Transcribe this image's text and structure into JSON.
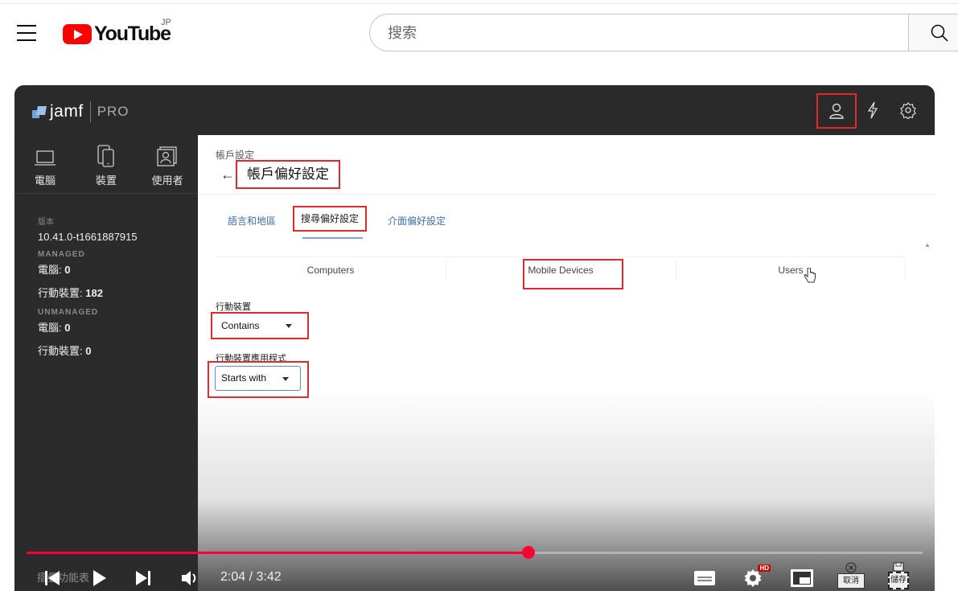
{
  "youtube": {
    "logo_text": "YouTube",
    "region": "JP",
    "search_placeholder": "搜索"
  },
  "jamf": {
    "brand": "jamf",
    "product": "PRO",
    "nav": [
      {
        "label": "電腦",
        "icon": "laptop-icon"
      },
      {
        "label": "裝置",
        "icon": "mobile-device-icon"
      },
      {
        "label": "使用者",
        "icon": "user-card-icon"
      }
    ],
    "info": {
      "version_label": "版本",
      "version": "10.41.0-t1661887915",
      "managed_label": "MANAGED",
      "managed_computers_label": "電腦:",
      "managed_computers": "0",
      "managed_devices_label": "行動裝置:",
      "managed_devices": "182",
      "unmanaged_label": "UNMANAGED",
      "unmanaged_computers_label": "電腦:",
      "unmanaged_computers": "0",
      "unmanaged_devices_label": "行動裝置:",
      "unmanaged_devices": "0"
    },
    "breadcrumb": "帳戶設定",
    "back_arrow": "←",
    "page_title": "帳戶偏好設定",
    "tabs": [
      "語言和地區",
      "搜尋偏好設定",
      "介面偏好設定"
    ],
    "active_tab": "搜尋偏好設定",
    "subtabs": [
      "Computers",
      "Mobile Devices",
      "Users"
    ],
    "active_subtab": "Mobile Devices",
    "fields": [
      {
        "label": "行動裝置",
        "value": "Contains"
      },
      {
        "label": "行動裝置應用程式",
        "value": "Starts with"
      }
    ]
  },
  "player": {
    "time": "2:04 / 3:42",
    "progress": 0.56,
    "chapter_ghost": "摺疊功能表",
    "hd_badge": "HD",
    "cancel_label": "取消",
    "save_label": "儲存"
  },
  "colors": {
    "youtube_red": "#ff0000",
    "progress_red": "#ff0033",
    "highlight_red": "#e02a2a",
    "jamf_dark": "#2a2a2a",
    "link_blue": "#3e6ea8"
  }
}
